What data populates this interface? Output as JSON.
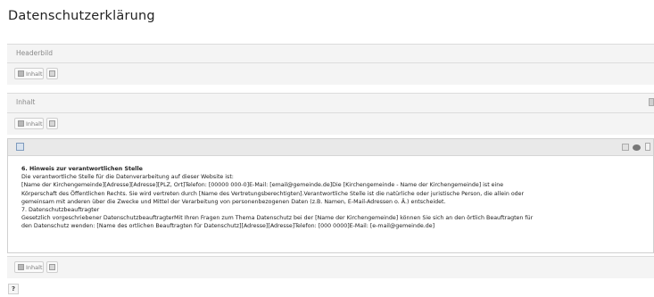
{
  "page": {
    "title": "Datenschutzerklärung"
  },
  "columns": {
    "headerbild": {
      "label": "Headerbild"
    },
    "inhalt": {
      "label": "Inhalt"
    }
  },
  "toolbar": {
    "new_content_label": "Inhalt"
  },
  "content_element": {
    "heading": "6. Hinweis zur verantwortlichen Stelle",
    "lines": [
      "Die verantwortliche Stelle für die Datenverarbeitung auf dieser Website ist:",
      "[Name der Kirchengemeinde][Adresse][Adresse][PLZ, Ort]Telefon: [00000 000-0]E-Mail: [email@gemeinde.de]Die [Kirchengemeinde - Name der Kirchengemeinde] ist eine",
      "Körperschaft des Öffentlichen Rechts. Sie wird vertreten durch [Name des Vertretungsberechtigten].Verantwortliche Stelle ist die natürliche oder juristische Person, die allein oder",
      "gemeinsam mit anderen über die Zwecke und Mittel der Verarbeitung von personenbezogenen Daten (z.B. Namen, E-Mail-Adressen o. Ä.) entscheidet.",
      "7. Datenschutzbeauftragter",
      "Gesetzlich vorgeschriebener DatenschutzbeauftragterMit Ihren Fragen zum Thema Datenschutz bei der [Name der Kirchengemeinde] können Sie sich an den örtlich Beauftragten für",
      "den Datenschutz wenden: [Name des ortlichen Beauftragten für Datenschutz][Adresse][Adresse]Telefon: [000 0000]E-Mail: [e-mail@gemeinde.de]"
    ]
  },
  "help": {
    "label": "?"
  }
}
